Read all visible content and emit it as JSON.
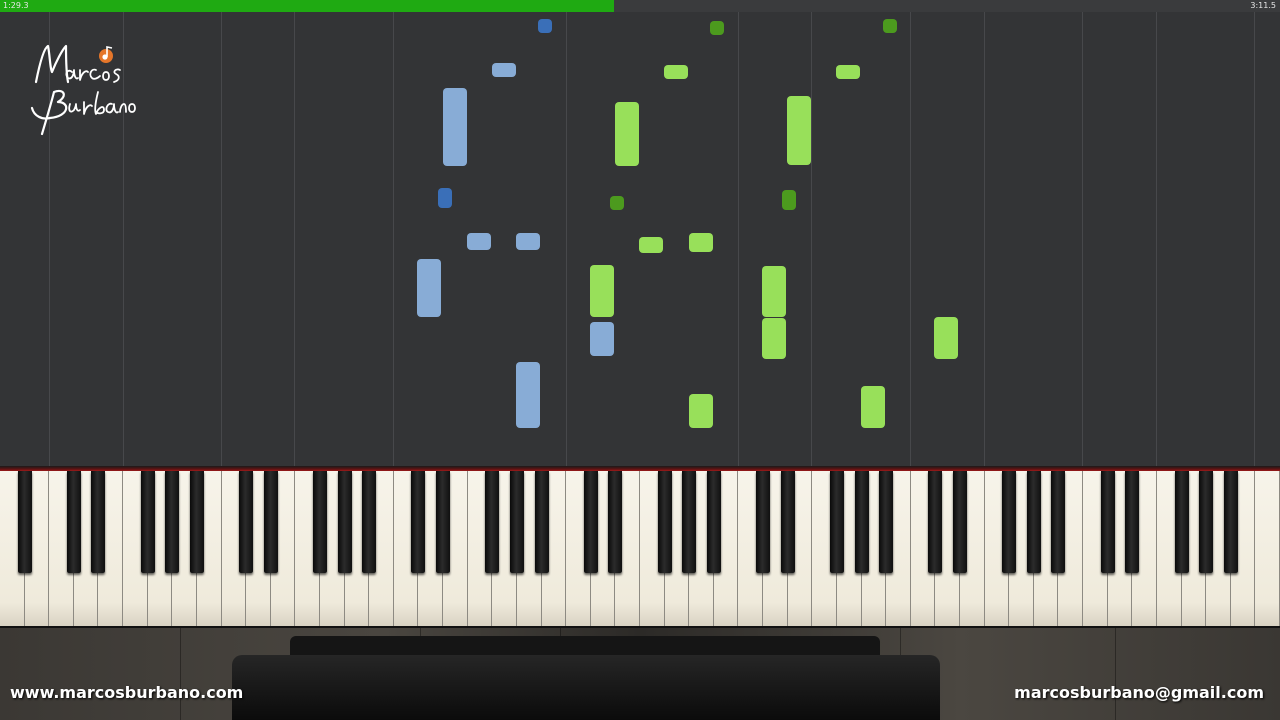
{
  "player": {
    "time_elapsed": "1:29.3",
    "time_total": "3:11.5",
    "progress_fraction": 0.48
  },
  "colors": {
    "left_hand": "#88acd6",
    "left_hand_sharp": "#3a6fb8",
    "right_hand": "#98e05a",
    "right_hand_sharp": "#4c9a1e",
    "progress": "#1faa12",
    "background": "#333436"
  },
  "logo": {
    "line1": "Marcos",
    "line2": "Burbano",
    "icon": "music-note-icon"
  },
  "footer": {
    "website": "www.marcosburbano.com",
    "email": "marcosburbano@gmail.com"
  },
  "notes": [
    {
      "hand": "left-sharp"
    },
    {
      "hand": "left"
    },
    {
      "hand": "left"
    },
    {
      "hand": "left-sharp"
    },
    {
      "hand": "left"
    },
    {
      "hand": "left"
    },
    {
      "hand": "left"
    },
    {
      "hand": "left"
    },
    {
      "hand": "left"
    },
    {
      "hand": "right-sharp"
    },
    {
      "hand": "right"
    },
    {
      "hand": "right"
    },
    {
      "hand": "right-sharp"
    },
    {
      "hand": "right"
    },
    {
      "hand": "right"
    },
    {
      "hand": "right"
    },
    {
      "hand": "right"
    },
    {
      "hand": "right-sharp"
    },
    {
      "hand": "right"
    },
    {
      "hand": "right"
    },
    {
      "hand": "right-sharp"
    },
    {
      "hand": "right"
    },
    {
      "hand": "right"
    },
    {
      "hand": "right"
    },
    {
      "hand": "right"
    }
  ]
}
